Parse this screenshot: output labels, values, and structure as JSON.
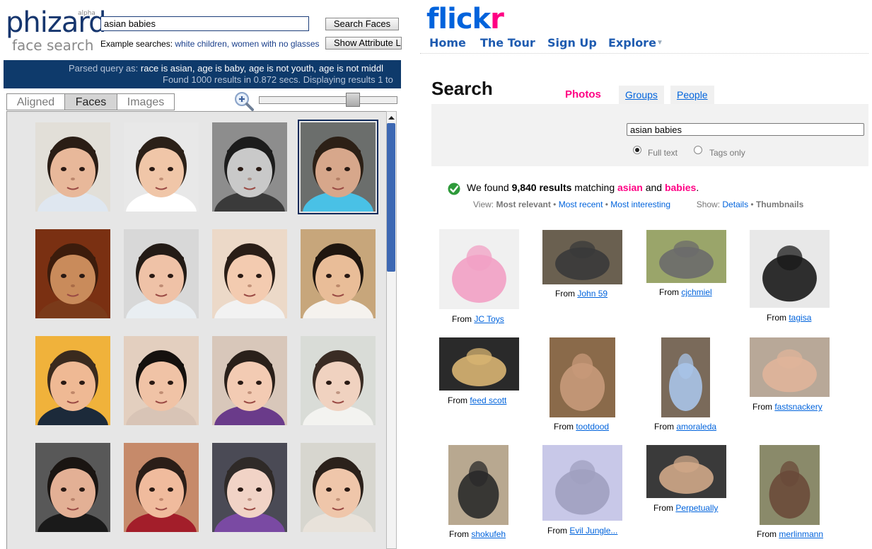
{
  "phizard": {
    "logo": "phizard",
    "logo_badge": "alpha",
    "subtitle": "face search",
    "search_value": "asian babies",
    "search_button": "Search Faces",
    "attribute_button": "Show Attribute L",
    "examples_label": "Example searches:",
    "example_1": "white children,",
    "example_2": "women with no glasses",
    "banner_parsed_prefix": "Parsed query as:",
    "banner_parsed_parts": [
      "race is asian,",
      "age is baby,",
      "age is not youth,",
      "age is not middl"
    ],
    "banner_found": "Found 1000 results in 0.872 secs. Displaying results 1 to",
    "tabs": [
      "Aligned",
      "Faces",
      "Images"
    ],
    "active_tab": "Faces",
    "zoom_icon": "magnifier-zoom-icon",
    "results": [
      {
        "bg": "#e2dfd8",
        "skin": "#e8b89a",
        "hair": "#2a1d15",
        "shirt": "#dfe7f0"
      },
      {
        "bg": "#e8e8e8",
        "skin": "#f0c6a8",
        "hair": "#2b2018",
        "shirt": "#ffffff"
      },
      {
        "bg": "#8d8d8d",
        "skin": "#c9c9c9",
        "hair": "#1c1c1c",
        "shirt": "#3a3a3a"
      },
      {
        "bg": "#6b6e6c",
        "skin": "#d7a78b",
        "hair": "#2c2016",
        "shirt": "#49c1e6"
      },
      {
        "bg": "#7a3012",
        "skin": "#c98b5b",
        "hair": "#3c1c0c",
        "shirt": "#7a3a1a"
      },
      {
        "bg": "#d8d8d8",
        "skin": "#efc2a7",
        "hair": "#231b16",
        "shirt": "#e9eef2"
      },
      {
        "bg": "#ecd9c8",
        "skin": "#f3cbb0",
        "hair": "#2a1e17",
        "shirt": "#f2f2f2"
      },
      {
        "bg": "#c7a67b",
        "skin": "#e9bd98",
        "hair": "#1f160f",
        "shirt": "#f5f2ee"
      },
      {
        "bg": "#f0b23b",
        "skin": "#efb994",
        "hair": "#3a2a1e",
        "shirt": "#1c2a3a"
      },
      {
        "bg": "#e3cfbf",
        "skin": "#f0c3a6",
        "hair": "#15110e",
        "shirt": "#d8c4b6"
      },
      {
        "bg": "#d8c7ba",
        "skin": "#f3cbb3",
        "hair": "#2a201a",
        "shirt": "#6a3b8a"
      },
      {
        "bg": "#d9dcd7",
        "skin": "#f0d2c0",
        "hair": "#3a2c24",
        "shirt": "#f3f3f0"
      },
      {
        "bg": "#585858",
        "skin": "#e3b095",
        "hair": "#1a1512",
        "shirt": "#1a1a1a"
      },
      {
        "bg": "#c68a6a",
        "skin": "#f0bb9d",
        "hair": "#2b1e18",
        "shirt": "#a31e2a"
      },
      {
        "bg": "#4a4a55",
        "skin": "#f1d3c6",
        "hair": "#2f2a28",
        "shirt": "#7a4aa3"
      },
      {
        "bg": "#d7d6cf",
        "skin": "#efc6aa",
        "hair": "#2b211b",
        "shirt": "#e8e2da"
      }
    ],
    "selected_index": 3
  },
  "flickr": {
    "logo_a": "flick",
    "logo_b": "r",
    "nav": [
      "Home",
      "The Tour",
      "Sign Up",
      "Explore"
    ],
    "nav_caret": "▼",
    "heading": "Search",
    "tabs": [
      "Photos",
      "Groups",
      "People"
    ],
    "active_tab": "Photos",
    "search_value": "asian babies",
    "radio_full": "Full text",
    "radio_tags": "Tags only",
    "found_prefix": "We found",
    "found_count": "9,840 results",
    "found_mid": "matching",
    "found_term1": "asian",
    "found_and": "and",
    "found_term2": "babies",
    "found_end": ".",
    "view_label": "View:",
    "view_opts": [
      "Most relevant",
      "Most recent",
      "Most interesting"
    ],
    "show_label": "Show:",
    "show_opts": [
      "Details",
      "Thumbnails"
    ],
    "from_label": "From",
    "results": [
      {
        "user": "JC Toys",
        "c1": "#f0f0f0",
        "c2": "#f2a0c4"
      },
      {
        "user": "John 59",
        "c1": "#6a6050",
        "c2": "#3a3a3a"
      },
      {
        "user": "cjchmiel",
        "c1": "#9aa56a",
        "c2": "#6b6b6b"
      },
      {
        "user": "tagisa",
        "c1": "#e8e8e8",
        "c2": "#1a1a1a"
      },
      {
        "user": "feed scott",
        "c1": "#2a2a2a",
        "c2": "#d8b472"
      },
      {
        "user": "tootdood",
        "c1": "#8a6a4a",
        "c2": "#c79a7a"
      },
      {
        "user": "amoraleda",
        "c1": "#7a6a5a",
        "c2": "#a8c4e8"
      },
      {
        "user": "fastsnackery",
        "c1": "#b8a898",
        "c2": "#e0b49a"
      },
      {
        "user": "shokufeh",
        "c1": "#b8a890",
        "c2": "#2a2a2a"
      },
      {
        "user": "Evil Jungle...",
        "c1": "#c8c8e8",
        "c2": "#a0a0c0"
      },
      {
        "user": "Perpetually",
        "c1": "#3a3a3a",
        "c2": "#d0a888"
      },
      {
        "user": "merlinmann",
        "c1": "#8a8a6a",
        "c2": "#6a4a3a"
      }
    ]
  }
}
